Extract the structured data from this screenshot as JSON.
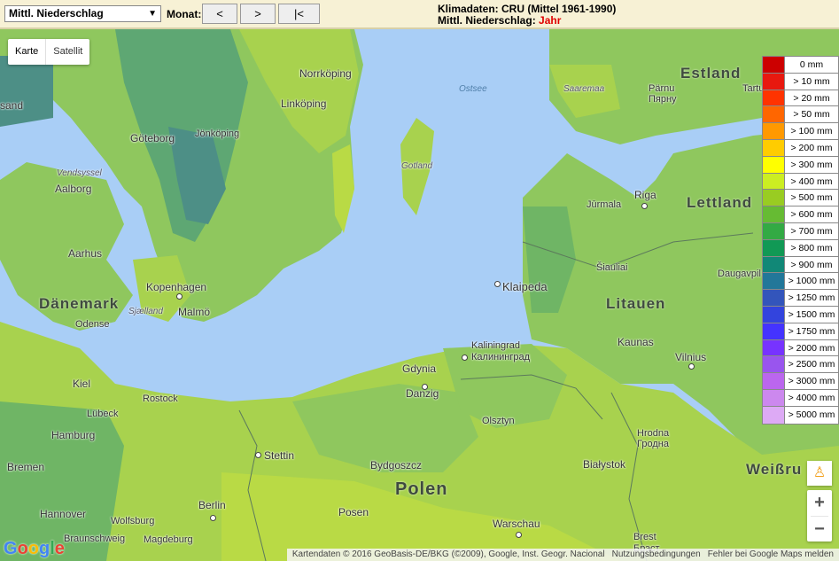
{
  "toolbar": {
    "select_value": "Mittl. Niederschlag",
    "month_label": "Monat:",
    "prev_label": "<",
    "next_label": ">",
    "first_label": "|<"
  },
  "info": {
    "line1": "Klimadaten: CRU (Mittel 1961-1990)",
    "line2_prefix": "Mittl. Niederschlag: ",
    "line2_value": "Jahr",
    "accent": "#e00000"
  },
  "map_type": {
    "map": "Karte",
    "satellite": "Satellit"
  },
  "labels": {
    "estland": "Estland",
    "lettland": "Lettland",
    "litauen": "Litauen",
    "polen": "Polen",
    "daenemark": "Dänemark",
    "ostsee": "Ostsee",
    "saaremaa": "Saaremaa",
    "gotland": "Gotland",
    "vendsyssel": "Vendsyssel",
    "sjaelland": "Sjælland",
    "sand": "sand",
    "norrkoping": "Norrköping",
    "linkoping": "Linköping",
    "jonkoping": "Jönköping",
    "goteborg": "Göteborg",
    "aalborg": "Aalborg",
    "aarhus": "Aarhus",
    "kopenhagen": "Kopenhagen",
    "malmo": "Malmö",
    "odense": "Odense",
    "kiel": "Kiel",
    "lubeck": "Lübeck",
    "rostock": "Rostock",
    "hamburg": "Hamburg",
    "bremen": "Bremen",
    "hannover": "Hannover",
    "wolfsburg": "Wolfsburg",
    "braunschweig": "Braunschweig",
    "magdeburg": "Magdeburg",
    "berlin": "Berlin",
    "stettin": "Stettin",
    "bydgoszcz": "Bydgoszcz",
    "posen": "Posen",
    "warschau": "Warschau",
    "bialystok": "Białystok",
    "brest": "Brest",
    "brest_cyr": "Брэст",
    "grodno": "Hrodna",
    "grodno_cyr": "Гродна",
    "danzig": "Danzig",
    "gdynia": "Gdynia",
    "olsztyn": "Olsztyn",
    "kaliningrad": "Kaliningrad",
    "kaliningrad_cyr": "Калининград",
    "klaipeda": "Klaipeda",
    "siauliai": "Šiauliai",
    "kaunas": "Kaunas",
    "vilnius": "Vilnius",
    "daugavpils": "Daugavpil",
    "riga": "Riga",
    "jurmala": "Jūrmala",
    "parnu": "Pärnu",
    "tartu": "Tartu",
    "tallinn_ru": "Пярну",
    "weissrussland": "Weißru"
  },
  "legend": [
    {
      "label": "0 mm",
      "color": "#cc0000"
    },
    {
      "label": "> 10 mm",
      "color": "#e8180f"
    },
    {
      "label": "> 20 mm",
      "color": "#ff3300"
    },
    {
      "label": "> 50 mm",
      "color": "#ff6600"
    },
    {
      "label": "> 100 mm",
      "color": "#ff9900"
    },
    {
      "label": "> 200 mm",
      "color": "#ffcc00"
    },
    {
      "label": "> 300 mm",
      "color": "#ffff00"
    },
    {
      "label": "> 400 mm",
      "color": "#ccee22"
    },
    {
      "label": "> 500 mm",
      "color": "#99cc22"
    },
    {
      "label": "> 600 mm",
      "color": "#66bb33"
    },
    {
      "label": "> 700 mm",
      "color": "#33aa44"
    },
    {
      "label": "> 800 mm",
      "color": "#119955"
    },
    {
      "label": "> 900 mm",
      "color": "#118877"
    },
    {
      "label": "> 1000 mm",
      "color": "#227799"
    },
    {
      "label": "> 1250 mm",
      "color": "#3355bb"
    },
    {
      "label": "> 1500 mm",
      "color": "#3344dd"
    },
    {
      "label": "> 1750 mm",
      "color": "#4433ff"
    },
    {
      "label": "> 2000 mm",
      "color": "#7733ff"
    },
    {
      "label": "> 2500 mm",
      "color": "#9955ee"
    },
    {
      "label": "> 3000 mm",
      "color": "#bb66ee"
    },
    {
      "label": "> 4000 mm",
      "color": "#cc88ee"
    },
    {
      "label": "> 5000 mm",
      "color": "#ddaaf5"
    }
  ],
  "zoom": {
    "in": "+",
    "out": "−"
  },
  "google_logo": "Google",
  "attribution": {
    "data": "Kartendaten © 2016 GeoBasis-DE/BKG (©2009), Google, Inst. Geogr. Nacional",
    "terms": "Nutzungsbedingungen",
    "report": "Fehler bei Google Maps melden"
  }
}
